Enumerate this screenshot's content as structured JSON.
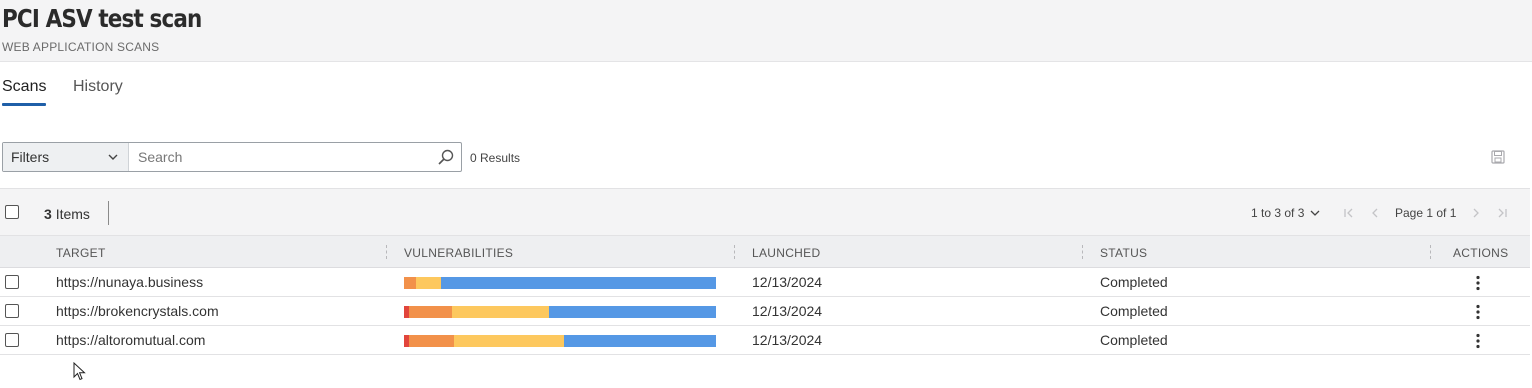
{
  "header": {
    "title": "PCI ASV test scan",
    "subtitle": "WEB APPLICATION SCANS"
  },
  "tabs": [
    {
      "label": "Scans",
      "active": true
    },
    {
      "label": "History",
      "active": false
    }
  ],
  "filter": {
    "filters_label": "Filters",
    "search_placeholder": "Search",
    "search_value": "",
    "results_text": "0 Results"
  },
  "toolbar": {
    "items_count": "3",
    "items_label": "Items",
    "range_text": "1 to 3 of 3",
    "page_text": "Page 1 of 1"
  },
  "table": {
    "columns": [
      "TARGET",
      "VULNERABILITIES",
      "LAUNCHED",
      "STATUS",
      "ACTIONS"
    ],
    "rows": [
      {
        "target": "https://nunaya.business",
        "launched": "12/13/2024",
        "status": "Completed",
        "vulnerability_shares": [
          {
            "severity": "critical",
            "share": 0.0,
            "color": "#e2453c"
          },
          {
            "severity": "high",
            "share": 0.04,
            "color": "#f2914a"
          },
          {
            "severity": "medium",
            "share": 0.08,
            "color": "#fdc85e"
          },
          {
            "severity": "low",
            "share": 0.88,
            "color": "#5598e5"
          }
        ]
      },
      {
        "target": "https://brokencrystals.com",
        "launched": "12/13/2024",
        "status": "Completed",
        "vulnerability_shares": [
          {
            "severity": "critical",
            "share": 0.016,
            "color": "#e2453c"
          },
          {
            "severity": "high",
            "share": 0.138,
            "color": "#f2914a"
          },
          {
            "severity": "medium",
            "share": 0.311,
            "color": "#fdc85e"
          },
          {
            "severity": "low",
            "share": 0.535,
            "color": "#5598e5"
          }
        ]
      },
      {
        "target": "https://altoromutual.com",
        "launched": "12/13/2024",
        "status": "Completed",
        "vulnerability_shares": [
          {
            "severity": "critical",
            "share": 0.016,
            "color": "#e2453c"
          },
          {
            "severity": "high",
            "share": 0.144,
            "color": "#f2914a"
          },
          {
            "severity": "medium",
            "share": 0.353,
            "color": "#fdc85e"
          },
          {
            "severity": "low",
            "share": 0.487,
            "color": "#5598e5"
          }
        ]
      }
    ]
  },
  "icons": {
    "filter_dropdown": "chevron-down-icon",
    "search": "search-icon",
    "save": "save-icon",
    "range_dropdown": "chevron-down-icon",
    "first_page": "first-page-icon",
    "prev_page": "chevron-left-icon",
    "next_page": "chevron-right-icon",
    "last_page": "last-page-icon",
    "row_actions": "kebab-menu-icon"
  },
  "colors": {
    "accent": "#1f5fa8",
    "header_bg": "#f4f4f5"
  }
}
